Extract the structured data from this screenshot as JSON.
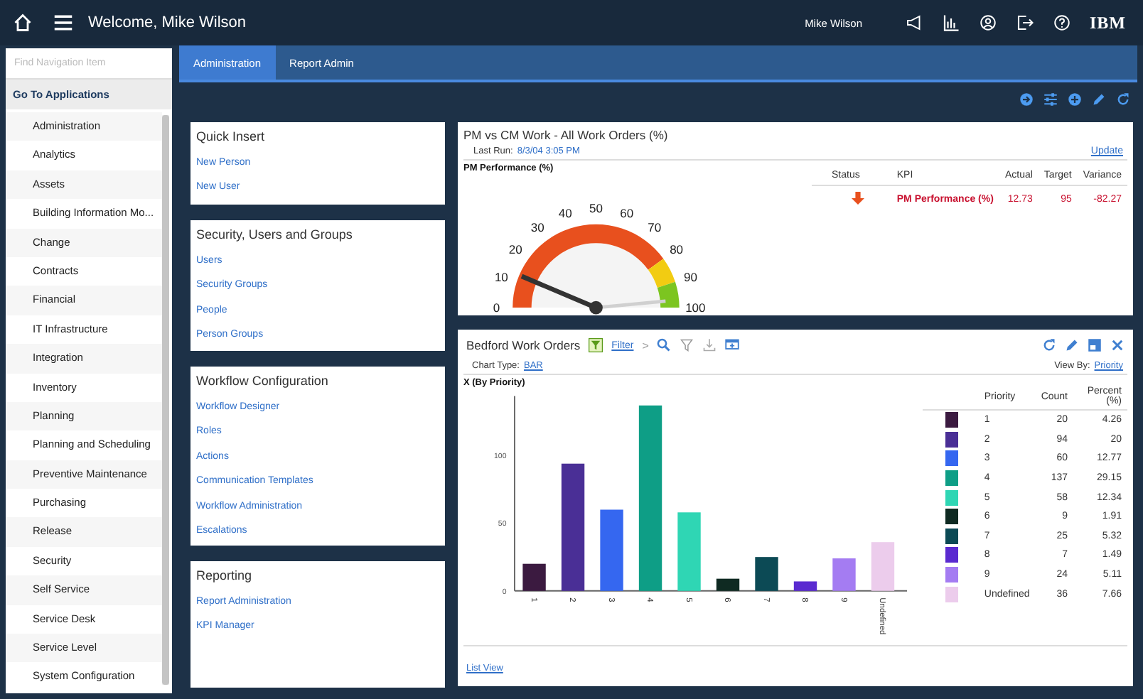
{
  "header": {
    "welcome": "Welcome, Mike Wilson",
    "user": "Mike Wilson",
    "logo": "IBM"
  },
  "sidebar": {
    "search": {
      "placeholder": "Find Navigation Item"
    },
    "heading": "Go To Applications",
    "items": [
      "Administration",
      "Analytics",
      "Assets",
      "Building Information Mo...",
      "Change",
      "Contracts",
      "Financial",
      "IT Infrastructure",
      "Integration",
      "Inventory",
      "Planning",
      "Planning and Scheduling",
      "Preventive Maintenance",
      "Purchasing",
      "Release",
      "Security",
      "Self Service",
      "Service Desk",
      "Service Level",
      "System Configuration"
    ]
  },
  "tabs": [
    {
      "label": "Administration",
      "selected": true
    },
    {
      "label": "Report Admin",
      "selected": false
    }
  ],
  "cards": [
    {
      "title": "Quick Insert",
      "links": [
        "New Person",
        "New User"
      ]
    },
    {
      "title": "Security, Users and Groups",
      "links": [
        "Users",
        "Security Groups",
        "People",
        "Person Groups"
      ]
    },
    {
      "title": "Workflow Configuration",
      "links": [
        "Workflow Designer",
        "Roles",
        "Actions",
        "Communication Templates",
        "Workflow Administration",
        "Escalations"
      ]
    },
    {
      "title": "Reporting",
      "links": [
        "Report Administration",
        "KPI Manager"
      ]
    }
  ],
  "kpi_panel": {
    "title": "PM vs CM Work - All Work Orders (%)",
    "last_run_label": "Last Run:",
    "last_run": "8/3/04 3:05 PM",
    "update": "Update",
    "gauge": {
      "title": "PM Performance (%)",
      "ticks": [
        "0",
        "10",
        "20",
        "30",
        "40",
        "50",
        "60",
        "70",
        "80",
        "90",
        "100"
      ]
    },
    "columns": [
      "Status",
      "KPI",
      "Actual",
      "Target",
      "Variance"
    ],
    "rows": [
      {
        "kind": "down",
        "kpi": "PM Performance (%)",
        "actual": "12.73",
        "target": "95",
        "variance": "-82.27"
      }
    ]
  },
  "orders_panel": {
    "title": "Bedford Work Orders",
    "filter": "Filter",
    "chevron": ">",
    "chart_type_label": "Chart Type:",
    "chart_type": "BAR",
    "view_by_label": "View By:",
    "view_by": "Priority",
    "chart_data": {
      "type": "bar",
      "title": "X (By Priority)",
      "categories": [
        "1",
        "2",
        "3",
        "4",
        "5",
        "6",
        "7",
        "8",
        "9",
        "Undefined"
      ],
      "values": [
        20,
        94,
        60,
        137,
        58,
        9,
        25,
        7,
        24,
        36
      ],
      "ylim": [
        0,
        140
      ],
      "yticks": [
        0,
        50,
        100
      ]
    },
    "legend_columns": [
      "Priority",
      "Count",
      "Percent (%)"
    ],
    "legend_rows": [
      {
        "priority": "1",
        "count": "20",
        "percent": "4.26",
        "color": "#3b1a40"
      },
      {
        "priority": "2",
        "count": "94",
        "percent": "20",
        "color": "#4a2f96"
      },
      {
        "priority": "3",
        "count": "60",
        "percent": "12.77",
        "color": "#3567f0"
      },
      {
        "priority": "4",
        "count": "137",
        "percent": "29.15",
        "color": "#0e9e86"
      },
      {
        "priority": "5",
        "count": "58",
        "percent": "12.34",
        "color": "#2fd6b4"
      },
      {
        "priority": "6",
        "count": "9",
        "percent": "1.91",
        "color": "#0f2a22"
      },
      {
        "priority": "7",
        "count": "25",
        "percent": "5.32",
        "color": "#0c4a55"
      },
      {
        "priority": "8",
        "count": "7",
        "percent": "1.49",
        "color": "#5a2ad0"
      },
      {
        "priority": "9",
        "count": "24",
        "percent": "5.11",
        "color": "#a47cf2"
      },
      {
        "priority": "Undefined",
        "count": "36",
        "percent": "7.66",
        "color": "#ecccec"
      }
    ],
    "list_view": "List View"
  }
}
